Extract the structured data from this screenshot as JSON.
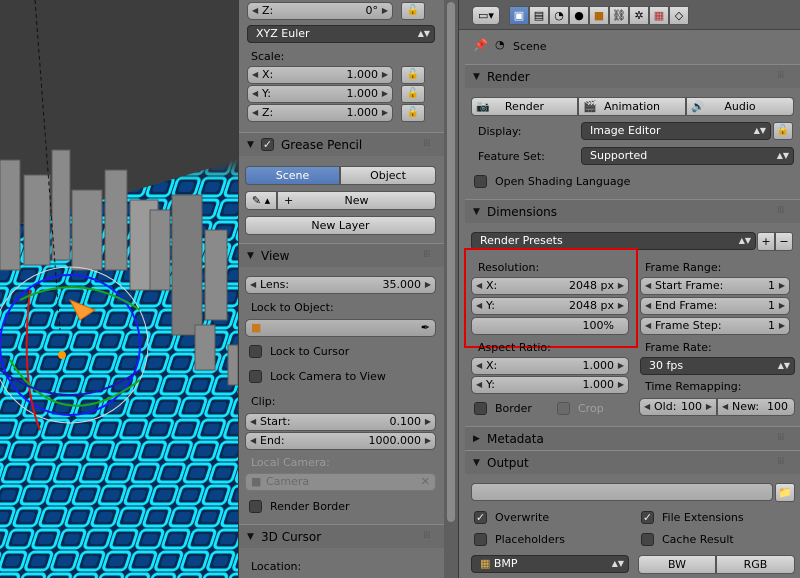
{
  "left_panel": {
    "z_rot": {
      "label": "Z:",
      "value": "0°"
    },
    "rotation_mode": "XYZ Euler",
    "scale": {
      "title": "Scale:",
      "x": {
        "label": "X:",
        "value": "1.000"
      },
      "y": {
        "label": "Y:",
        "value": "1.000"
      },
      "z": {
        "label": "Z:",
        "value": "1.000"
      }
    },
    "grease_pencil": {
      "title": "Grease Pencil",
      "tab_scene": "Scene",
      "tab_object": "Object",
      "new_label": "New",
      "new_layer_label": "New Layer"
    },
    "view": {
      "title": "View",
      "lens": {
        "label": "Lens:",
        "value": "35.000"
      },
      "lock_to_object": "Lock to Object:",
      "lock_to_cursor": "Lock to Cursor",
      "lock_camera_to_view": "Lock Camera to View",
      "clip": "Clip:",
      "clip_start": {
        "label": "Start:",
        "value": "0.100"
      },
      "clip_end": {
        "label": "End:",
        "value": "1000.000"
      },
      "local_camera": "Local Camera:",
      "camera": "Camera",
      "render_border": "Render Border"
    },
    "cursor": {
      "title": "3D Cursor",
      "location": "Location:"
    }
  },
  "properties": {
    "breadcrumb": "Scene",
    "render": {
      "title": "Render",
      "render_btn": "Render",
      "animation_btn": "Animation",
      "audio_btn": "Audio",
      "display_label": "Display:",
      "display_value": "Image Editor",
      "feature_set_label": "Feature Set:",
      "feature_set_value": "Supported",
      "osl": "Open Shading Language"
    },
    "dimensions": {
      "title": "Dimensions",
      "presets": "Render Presets",
      "resolution": "Resolution:",
      "res_x": {
        "label": "X:",
        "value": "2048 px"
      },
      "res_y": {
        "label": "Y:",
        "value": "2048 px"
      },
      "res_pct": "100%",
      "aspect": "Aspect Ratio:",
      "asp_x": {
        "label": "X:",
        "value": "1.000"
      },
      "asp_y": {
        "label": "Y:",
        "value": "1.000"
      },
      "border": "Border",
      "crop": "Crop",
      "frame_range": "Frame Range:",
      "start_frame": {
        "label": "Start Frame:",
        "value": "1"
      },
      "end_frame": {
        "label": "End Frame:",
        "value": "1"
      },
      "frame_step": {
        "label": "Frame Step:",
        "value": "1"
      },
      "frame_rate": "Frame Rate:",
      "fps": "30 fps",
      "time_remap": "Time Remapping:",
      "old": {
        "label": "Old:",
        "value": "100"
      },
      "new": {
        "label": "New:",
        "value": "100"
      }
    },
    "metadata": {
      "title": "Metadata"
    },
    "output": {
      "title": "Output",
      "path": "",
      "overwrite": "Overwrite",
      "file_extensions": "File Extensions",
      "placeholders": "Placeholders",
      "cache_result": "Cache Result",
      "format": "BMP",
      "bw": "BW",
      "rgb": "RGB"
    }
  },
  "colors": {
    "highlight": "#e00000",
    "selected": "#5680c2",
    "grid": "#00c8ff"
  }
}
